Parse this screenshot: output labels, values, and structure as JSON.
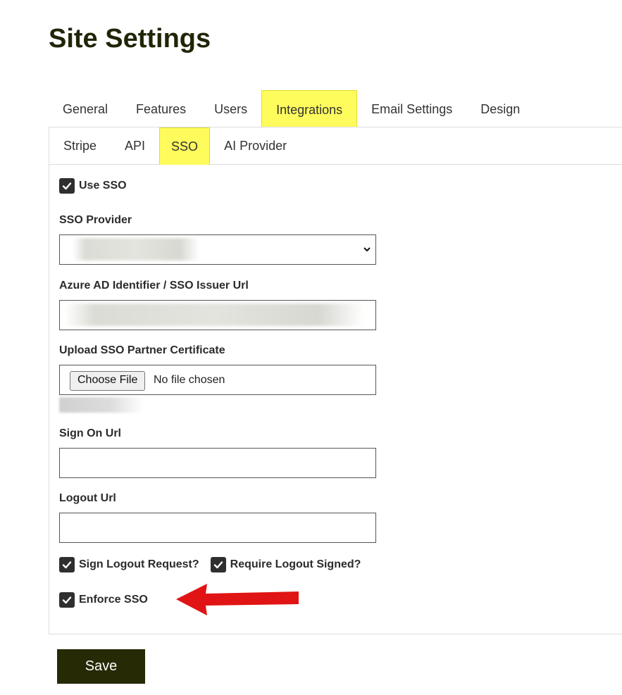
{
  "page": {
    "title": "Site Settings"
  },
  "tabs": [
    {
      "label": "General"
    },
    {
      "label": "Features"
    },
    {
      "label": "Users"
    },
    {
      "label": "Integrations",
      "active": true
    },
    {
      "label": "Email Settings"
    },
    {
      "label": "Design"
    }
  ],
  "subtabs": [
    {
      "label": "Stripe"
    },
    {
      "label": "API"
    },
    {
      "label": "SSO",
      "active": true
    },
    {
      "label": "AI Provider"
    }
  ],
  "form": {
    "use_sso": {
      "label": "Use SSO",
      "checked": true
    },
    "sso_provider": {
      "label": "SSO Provider"
    },
    "issuer_url": {
      "label": "Azure AD Identifier / SSO Issuer Url"
    },
    "certificate": {
      "label": "Upload SSO Partner Certificate",
      "button_label": "Choose File",
      "status": "No file chosen"
    },
    "sign_on_url": {
      "label": "Sign On Url",
      "value": ""
    },
    "logout_url": {
      "label": "Logout Url",
      "value": ""
    },
    "sign_logout_request": {
      "label": "Sign Logout Request?",
      "checked": true
    },
    "require_logout_signed": {
      "label": "Require Logout Signed?",
      "checked": true
    },
    "enforce_sso": {
      "label": "Enforce SSO",
      "checked": true
    }
  },
  "actions": {
    "save_label": "Save"
  },
  "colors": {
    "tab_highlight": "#fefb5c",
    "primary_dark": "#262a05",
    "title": "#1f2608",
    "annotation_arrow": "#e01414"
  },
  "icons": {
    "checkbox": "check-icon",
    "select": "chevron-down-icon",
    "annotation": "red-arrow-icon"
  }
}
